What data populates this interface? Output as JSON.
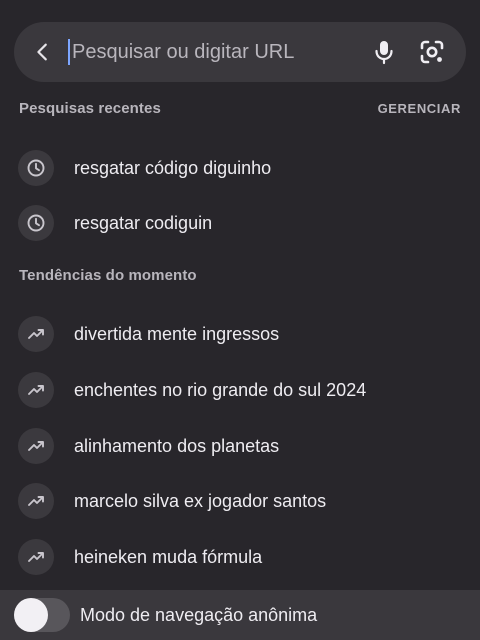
{
  "search": {
    "placeholder": "Pesquisar ou digitar URL",
    "value": ""
  },
  "recent": {
    "title": "Pesquisas recentes",
    "manage_label": "GERENCIAR",
    "items": [
      {
        "label": "resgatar código diguinho",
        "icon": "history-clock-icon"
      },
      {
        "label": "resgatar codiguin",
        "icon": "history-clock-icon"
      }
    ]
  },
  "trending": {
    "title": "Tendências do momento",
    "items": [
      {
        "label": "divertida mente ingressos",
        "icon": "trending-up-icon"
      },
      {
        "label": "enchentes no rio grande do sul 2024",
        "icon": "trending-up-icon"
      },
      {
        "label": "alinhamento dos planetas",
        "icon": "trending-up-icon"
      },
      {
        "label": "marcelo silva ex jogador santos",
        "icon": "trending-up-icon"
      },
      {
        "label": "heineken muda fórmula",
        "icon": "trending-up-icon"
      }
    ]
  },
  "incognito": {
    "label": "Modo de navegação anônima",
    "enabled": false
  },
  "colors": {
    "background": "#28262b",
    "surface": "#3a383d",
    "accent_caret": "#7da6ff"
  }
}
